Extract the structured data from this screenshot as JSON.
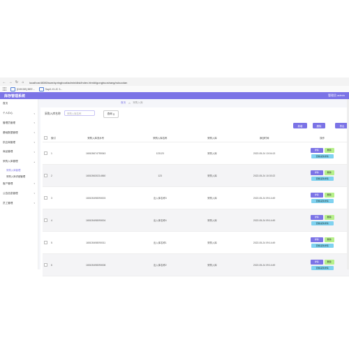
{
  "browser": {
    "url": "localhost:8080/ssm/springboot/admin/dist/index.html#/gonghuoshang/rukuodan",
    "bookmarks": [
      {
        "label": "[DHKDB] BEE..."
      },
      {
        "label": "Sap0-Xf-JC 3..."
      }
    ]
  },
  "app": {
    "title": "库存管理系统",
    "admin_label": "管理员 admin"
  },
  "sidebar": {
    "items": [
      {
        "label": "首页"
      },
      {
        "label": "个人中心"
      },
      {
        "label": "管理员管理"
      },
      {
        "label": "基础数据管理"
      },
      {
        "label": "供应商管理"
      },
      {
        "label": "商品管理"
      },
      {
        "label": "采购入库管理"
      }
    ],
    "sub_items": [
      {
        "label": "采购入库管理"
      },
      {
        "label": "采购入库详细管理"
      }
    ],
    "items_after": [
      {
        "label": "客户管理"
      },
      {
        "label": "公告信息管理"
      },
      {
        "label": "员工管理"
      }
    ]
  },
  "breadcrumb": {
    "first": "首页",
    "second": "采购入库"
  },
  "search": {
    "label": "采购入库名称",
    "placeholder": "采购入库名称",
    "button": "查询"
  },
  "actions": {
    "add": "新增",
    "delete": "删除",
    "export": "导出"
  },
  "table": {
    "headers": [
      "索引",
      "采购入库流水号",
      "采购入库名称",
      "采购入库",
      "添加时间",
      "操作"
    ],
    "rows": [
      {
        "index": "1",
        "code": "165105674759343",
        "name": "123123",
        "type": "采购入库",
        "time": "2022-05-24 13:04:13"
      },
      {
        "index": "2",
        "code": "165105630214560",
        "name": "123",
        "type": "采购入库",
        "time": "2022-05-24 10:30:22"
      },
      {
        "index": "3",
        "code": "165105498090003",
        "name": "出入库名称3",
        "type": "采购入库",
        "time": "2022-05-24 09:14:49"
      },
      {
        "index": "4",
        "code": "165105498090004",
        "name": "出入库名称4",
        "type": "采购入库",
        "time": "2022-05-24 09:14:49"
      },
      {
        "index": "5",
        "code": "165105498090011",
        "name": "出入库名称1",
        "type": "采购入库",
        "time": "2022-05-24 09:14:49"
      },
      {
        "index": "6",
        "code": "165105498090008",
        "name": "出入库名称2",
        "type": "采购入库",
        "time": "2022-05-24 09:14:49"
      }
    ],
    "op_detail": "详情",
    "op_delete": "删除",
    "op_view": "查看采购详情"
  },
  "colors": {
    "accent": "#7b73e6",
    "delete": "#b6f08a",
    "view": "#7fd2f0"
  }
}
